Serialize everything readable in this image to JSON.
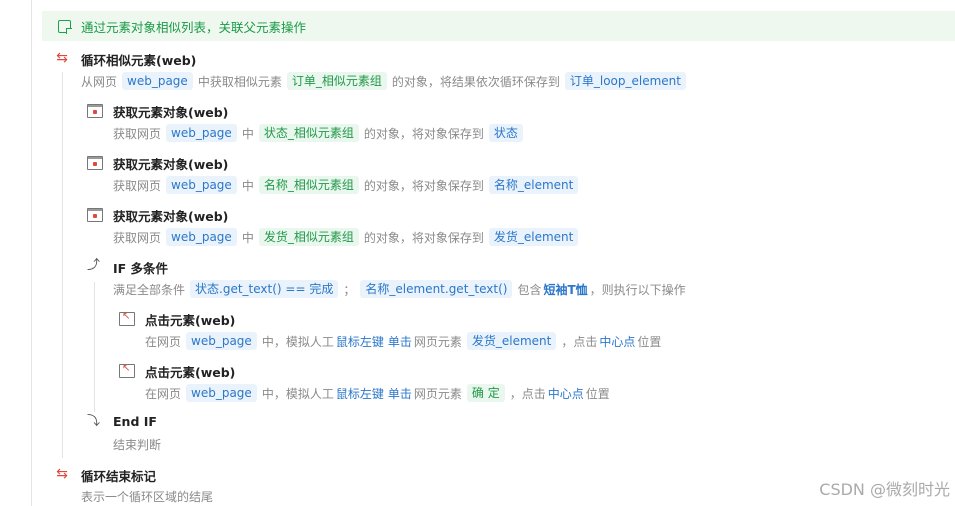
{
  "comment": "通过元素对象相似列表，关联父元素操作",
  "loop": {
    "title": "循环相似元素(web)",
    "d": [
      "从网页",
      "web_page",
      "中获取相似元素",
      "订单_相似元素组",
      "的对象，将结果依次循环保存到",
      "订单_loop_element"
    ]
  },
  "get1": {
    "title": "获取元素对象(web)",
    "d": [
      "获取网页",
      "web_page",
      "中",
      "状态_相似元素组",
      "的对象，将对象保存到",
      "状态"
    ]
  },
  "get2": {
    "title": "获取元素对象(web)",
    "d": [
      "获取网页",
      "web_page",
      "中",
      "名称_相似元素组",
      "的对象，将对象保存到",
      "名称_element"
    ]
  },
  "get3": {
    "title": "获取元素对象(web)",
    "d": [
      "获取网页",
      "web_page",
      "中",
      "发货_相似元素组",
      "的对象，将对象保存到",
      "发货_element"
    ]
  },
  "ifblock": {
    "title": "IF 多条件",
    "d": [
      "满足全部条件",
      "状态.get_text()",
      "==",
      "完成",
      "；",
      "名称_element.get_text()",
      "包含",
      "短袖T恤",
      "，",
      "则执行以下操作"
    ]
  },
  "click1": {
    "title": "点击元素(web)",
    "d": [
      "在网页",
      "web_page",
      "中，模拟人工",
      "鼠标左键",
      "单击",
      "网页元素",
      "发货_element",
      "，点击",
      "中心点",
      "位置"
    ]
  },
  "click2": {
    "title": "点击元素(web)",
    "d": [
      "在网页",
      "web_page",
      "中，模拟人工",
      "鼠标左键",
      "单击",
      "网页元素",
      "确 定",
      "，点击",
      "中心点",
      "位置"
    ]
  },
  "endif": {
    "title": "End IF",
    "desc": "结束判断"
  },
  "loopend": {
    "title": "循环结束标记",
    "desc": "表示一个循环区域的结尾"
  },
  "watermark": "CSDN @微刻时光"
}
